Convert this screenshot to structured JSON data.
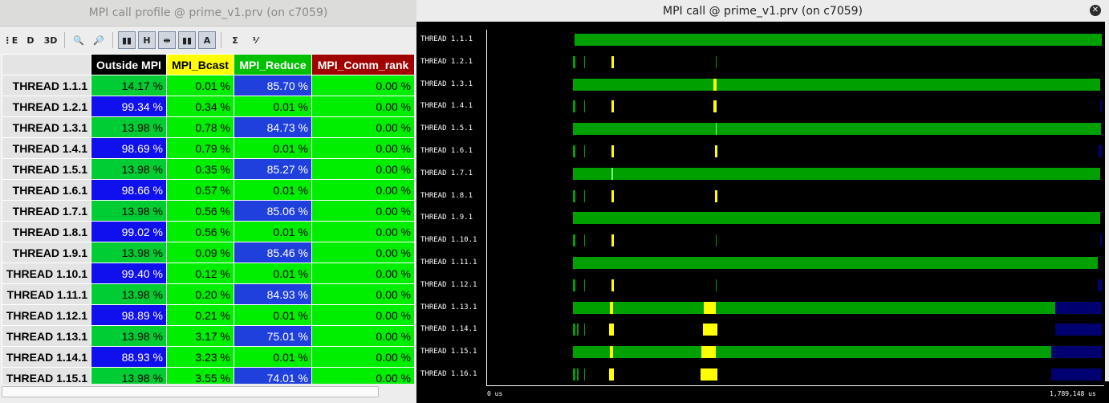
{
  "left_window": {
    "title": "MPI call profile @ prime_v1.prv (on c7059)",
    "toolbar": [
      {
        "icon": "open-control-window-icon",
        "text": "⋮E"
      },
      {
        "icon": "open-data-window-icon",
        "text": "D"
      },
      {
        "icon": "3d-view-icon",
        "text": "3D"
      },
      {
        "icon": "search-icon",
        "text": "🔍"
      },
      {
        "icon": "zoom-settings-icon",
        "text": "🔎"
      },
      {
        "icon": "color-mode-icon",
        "text": "▮▮"
      },
      {
        "icon": "horizontal-icon",
        "text": "H"
      },
      {
        "icon": "hide-columns-icon",
        "text": "⇹"
      },
      {
        "icon": "gradient-color-icon",
        "text": "▮▮"
      },
      {
        "icon": "label-mode-icon",
        "text": "A"
      },
      {
        "icon": "sum-icon",
        "text": "Σ"
      },
      {
        "icon": "fraction-icon",
        "text": "⅟"
      }
    ],
    "columns": [
      {
        "label": "Outside MPI",
        "bg": "#000000",
        "fg": "#ffffff"
      },
      {
        "label": "MPI_Bcast",
        "bg": "#ffff00",
        "fg": "#000000"
      },
      {
        "label": "MPI_Reduce",
        "bg": "#00c000",
        "fg": "#ffffff"
      },
      {
        "label": "MPI_Comm_rank",
        "bg": "#a00000",
        "fg": "#ffffff"
      }
    ],
    "rows": [
      {
        "thread": "THREAD 1.1.1",
        "values": [
          "14.17 %",
          "0.01 %",
          "85.70 %",
          "0.00 %"
        ],
        "colors": [
          "c-green2",
          "c-green",
          "c-blue2",
          "c-green"
        ]
      },
      {
        "thread": "THREAD 1.2.1",
        "values": [
          "99.34 %",
          "0.34 %",
          "0.01 %",
          "0.00 %"
        ],
        "colors": [
          "c-blue",
          "c-green",
          "c-green",
          "c-green"
        ]
      },
      {
        "thread": "THREAD 1.3.1",
        "values": [
          "13.98 %",
          "0.78 %",
          "84.73 %",
          "0.00 %"
        ],
        "colors": [
          "c-green2",
          "c-green",
          "c-blue2",
          "c-green"
        ]
      },
      {
        "thread": "THREAD 1.4.1",
        "values": [
          "98.69 %",
          "0.79 %",
          "0.01 %",
          "0.00 %"
        ],
        "colors": [
          "c-blue",
          "c-green",
          "c-green",
          "c-green"
        ]
      },
      {
        "thread": "THREAD 1.5.1",
        "values": [
          "13.98 %",
          "0.35 %",
          "85.27 %",
          "0.00 %"
        ],
        "colors": [
          "c-green2",
          "c-green",
          "c-blue2",
          "c-green"
        ]
      },
      {
        "thread": "THREAD 1.6.1",
        "values": [
          "98.66 %",
          "0.57 %",
          "0.01 %",
          "0.00 %"
        ],
        "colors": [
          "c-blue",
          "c-green",
          "c-green",
          "c-green"
        ]
      },
      {
        "thread": "THREAD 1.7.1",
        "values": [
          "13.98 %",
          "0.56 %",
          "85.06 %",
          "0.00 %"
        ],
        "colors": [
          "c-green2",
          "c-green",
          "c-blue2",
          "c-green"
        ]
      },
      {
        "thread": "THREAD 1.8.1",
        "values": [
          "99.02 %",
          "0.56 %",
          "0.01 %",
          "0.00 %"
        ],
        "colors": [
          "c-blue",
          "c-green",
          "c-green",
          "c-green"
        ]
      },
      {
        "thread": "THREAD 1.9.1",
        "values": [
          "13.98 %",
          "0.09 %",
          "85.46 %",
          "0.00 %"
        ],
        "colors": [
          "c-green2",
          "c-green",
          "c-blue2",
          "c-green"
        ]
      },
      {
        "thread": "THREAD 1.10.1",
        "values": [
          "99.40 %",
          "0.12 %",
          "0.01 %",
          "0.00 %"
        ],
        "colors": [
          "c-blue",
          "c-green",
          "c-green",
          "c-green"
        ]
      },
      {
        "thread": "THREAD 1.11.1",
        "values": [
          "13.98 %",
          "0.20 %",
          "84.93 %",
          "0.00 %"
        ],
        "colors": [
          "c-green2",
          "c-green",
          "c-blue2",
          "c-green"
        ]
      },
      {
        "thread": "THREAD 1.12.1",
        "values": [
          "98.89 %",
          "0.21 %",
          "0.01 %",
          "0.00 %"
        ],
        "colors": [
          "c-blue",
          "c-green",
          "c-green",
          "c-green"
        ]
      },
      {
        "thread": "THREAD 1.13.1",
        "values": [
          "13.98 %",
          "3.17 %",
          "75.01 %",
          "0.00 %"
        ],
        "colors": [
          "c-green2",
          "c-green",
          "c-blue2",
          "c-green"
        ]
      },
      {
        "thread": "THREAD 1.14.1",
        "values": [
          "88.93 %",
          "3.23 %",
          "0.01 %",
          "0.00 %"
        ],
        "colors": [
          "c-blue",
          "c-green",
          "c-green",
          "c-green"
        ]
      },
      {
        "thread": "THREAD 1.15.1",
        "values": [
          "13.98 %",
          "3.55 %",
          "74.01 %",
          "0.00 %"
        ],
        "colors": [
          "c-green2",
          "c-green",
          "c-blue2",
          "c-green"
        ]
      }
    ]
  },
  "right_window": {
    "title": "MPI call @ prime_v1.prv (on c7059)",
    "close_icon": "close-icon",
    "axis_start": "0 us",
    "axis_end": "1,789,148 us",
    "colors": {
      "reduce": "#00a000",
      "bcast": "#ffff00",
      "outside_tail": "#000070",
      "comm_rank": "#a00000"
    },
    "threads": [
      "THREAD 1.1.1",
      "THREAD 1.2.1",
      "THREAD 1.3.1",
      "THREAD 1.4.1",
      "THREAD 1.5.1",
      "THREAD 1.6.1",
      "THREAD 1.7.1",
      "THREAD 1.8.1",
      "THREAD 1.9.1",
      "THREAD 1.10.1",
      "THREAD 1.11.1",
      "THREAD 1.12.1",
      "THREAD 1.13.1",
      "THREAD 1.14.1",
      "THREAD 1.15.1",
      "THREAD 1.16.1"
    ]
  }
}
